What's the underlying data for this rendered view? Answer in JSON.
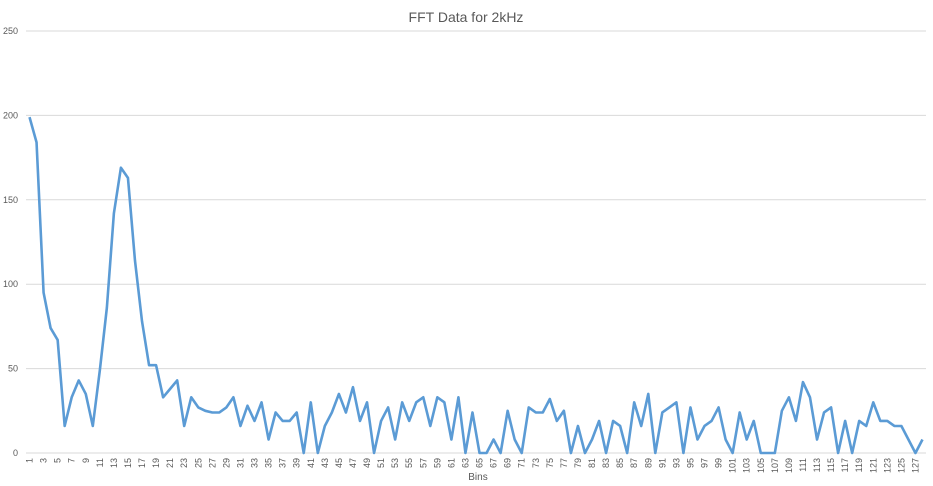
{
  "chart_data": {
    "type": "line",
    "title": "FFT Data for 2kHz",
    "xlabel": "Bins",
    "ylabel": "",
    "ylim": [
      0,
      250
    ],
    "yticks": [
      0,
      50,
      100,
      150,
      200,
      250
    ],
    "grid": true,
    "legend": "none",
    "color": "#5b9bd5",
    "x": [
      1,
      2,
      3,
      4,
      5,
      6,
      7,
      8,
      9,
      10,
      11,
      12,
      13,
      14,
      15,
      16,
      17,
      18,
      19,
      20,
      21,
      22,
      23,
      24,
      25,
      26,
      27,
      28,
      29,
      30,
      31,
      32,
      33,
      34,
      35,
      36,
      37,
      38,
      39,
      40,
      41,
      42,
      43,
      44,
      45,
      46,
      47,
      48,
      49,
      50,
      51,
      52,
      53,
      54,
      55,
      56,
      57,
      58,
      59,
      60,
      61,
      62,
      63,
      64,
      65,
      66,
      67,
      68,
      69,
      70,
      71,
      72,
      73,
      74,
      75,
      76,
      77,
      78,
      79,
      80,
      81,
      82,
      83,
      84,
      85,
      86,
      87,
      88,
      89,
      90,
      91,
      92,
      93,
      94,
      95,
      96,
      97,
      98,
      99,
      100,
      101,
      102,
      103,
      104,
      105,
      106,
      107,
      108,
      109,
      110,
      111,
      112,
      113,
      114,
      115,
      116,
      117,
      118,
      119,
      120,
      121,
      122,
      123,
      124,
      125,
      126,
      127,
      128
    ],
    "values": [
      199,
      184,
      95,
      74,
      67,
      16,
      33,
      43,
      35,
      16,
      49,
      86,
      142,
      169,
      163,
      114,
      78,
      52,
      52,
      33,
      38,
      43,
      16,
      33,
      27,
      25,
      24,
      24,
      27,
      33,
      16,
      28,
      19,
      30,
      8,
      24,
      19,
      19,
      24,
      0,
      30,
      0,
      16,
      24,
      35,
      24,
      39,
      19,
      30,
      0,
      19,
      27,
      8,
      30,
      19,
      30,
      33,
      16,
      33,
      30,
      8,
      33,
      0,
      24,
      0,
      0,
      8,
      0,
      25,
      8,
      0,
      27,
      24,
      24,
      32,
      19,
      25,
      0,
      16,
      0,
      8,
      19,
      0,
      19,
      16,
      0,
      30,
      16,
      35,
      0,
      24,
      27,
      30,
      0,
      27,
      8,
      16,
      19,
      27,
      8,
      0,
      24,
      8,
      19,
      0,
      0,
      0,
      25,
      33,
      19,
      42,
      33,
      8,
      24,
      27,
      0,
      19,
      0,
      19,
      16,
      30,
      19,
      19,
      16,
      16,
      8,
      0,
      8
    ]
  }
}
